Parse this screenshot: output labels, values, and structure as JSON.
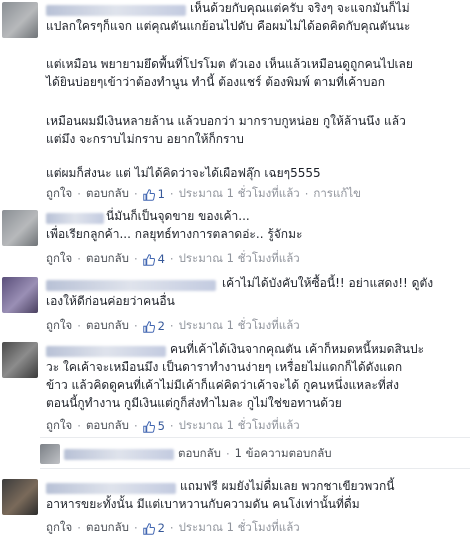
{
  "c1": {
    "lines": [
      "เห็นด้วยกับคุณแต่ครับ จริงๆ จะแจกมันก็ไม่",
      "แปลกใครๆก็แจก แต่คุณตันแกย้อนไปดับ คือผมไม่ได้อดคิดกับคุณตันนะ",
      "",
      "แต่เหมือน พยายามยึดพื้นที่โปรโมต ตัวเอง เห็นแล้วเหมือนดูถูกคนไปเลย",
      "ได้ยินบ่อยๆเข้าว่าต้องทำนูน ทำนี้ ต้องแชร์ ต้องพิมพ์ ตามที่เค้าบอก",
      "",
      "เหมือนผมมีเงินหลายล้าน แล้วบอกว่า มากราบกูหน่อย กูให้ล้านนึง แล้ว",
      "แต่มึง จะกราบไม่กราบ อยากให้ก็กราบ",
      "",
      "แต่ผมก็ส่งนะ แต่ ไม่ได้คิดว่าจะได้เผือฟลุ๊ก เฉยๆ5555"
    ],
    "like": "ถูกใจ",
    "reply": "ตอบกลับ",
    "likes": "1",
    "time": "ประมาณ 1 ชั่วโมงที่แล้ว",
    "edited": "การแก้ไข"
  },
  "c2": {
    "lines": [
      "นี่มันก็เป็นจุดขาย ของเค้า...",
      "เพื่อเรียกลูกค้า... กลยุทธ์ทางการตลาดอ่ะ.. รู้จักมะ"
    ],
    "like": "ถูกใจ",
    "reply": "ตอบกลับ",
    "likes": "4",
    "time": "ประมาณ 1 ชั่วโมงที่แล้ว"
  },
  "c3": {
    "lines": [
      "เค้าไม่ได้บังคับให้ซื้อนี้!! อย่าแสดง!! ดูตัง",
      "เองให้ดีก่อนค่อยว่าคนอื่น"
    ],
    "like": "ถูกใจ",
    "reply": "ตอบกลับ",
    "likes": "2",
    "time": "ประมาณ 1 ชั่วโมงที่แล้ว"
  },
  "c4": {
    "lines": [
      "คนที่เค้าได้เงินจากคุณตัน เค้าก็หมดหนี้หมดสินปะ",
      "วะ ใคเค้าจะเหมือนมึง เป็นดาราทำงานง่ายๆ เหรื่อยไม่แดกก็ได้ดังแดก",
      "ข้าว แล้วคิดดูคนที่เค้าไม่มีเค้าก็แค่คิดว่าเค้าจะได้ กูคนหนึ่งแหละที่ส่ง",
      "ตอนนี้กูทำงาน กูมีเงินแต่กูก็ส่งทำไมละ กูไม่ใช่ขอทานด้วย"
    ],
    "like": "ถูกใจ",
    "reply": "ตอบกลับ",
    "likes": "5",
    "time": "ประมาณ 1 ชั่วโมงที่แล้ว"
  },
  "reply_row": {
    "reply": "ตอบกลับ",
    "count": "1 ข้อความตอบกลับ"
  },
  "c5": {
    "lines": [
      "แถมฟรี ผมยังไม่ดื่มเลย พวกชาเขียวพวกนี้",
      "อาหารขยะทั้งนั้น มีแต่เบาหวานกับความดัน คนโง่เท่านั้นที่ดื่ม"
    ],
    "like": "ถูกใจ",
    "reply": "ตอบกลับ",
    "likes": "2",
    "time": "ประมาณ 1 ชั่วโมงที่แล้ว"
  },
  "colors": {
    "link": "#365899",
    "meta": "#90949c",
    "text": "#1d2129"
  }
}
